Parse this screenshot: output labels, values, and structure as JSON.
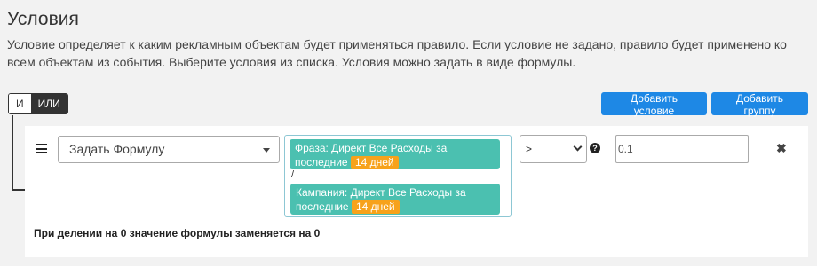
{
  "header": {
    "title": "Условия",
    "description": "Условие определяет к каким рекламным объектам будет применяться правило. Если условие не задано, правило будет применено ко всем объектам из события. Выберите условия из списка. Условия можно задать в виде формулы."
  },
  "logic_toggle": {
    "and_label": "И",
    "or_label": "ИЛИ",
    "selected": "ИЛИ"
  },
  "actions": {
    "add_condition_label": "Добавить условие",
    "add_group_label": "Добавить группу"
  },
  "condition": {
    "type_select": {
      "value": "Задать Формулу"
    },
    "formula": {
      "term1": {
        "text": "Фраза: Директ Все Расходы за последние",
        "period": "14 дней"
      },
      "operator": "/",
      "term2": {
        "text": "Кампания: Директ Все Расходы за последние",
        "period": "14 дней"
      }
    },
    "comparison_select": {
      "value": ">"
    },
    "value_input": {
      "value": "0.1"
    },
    "help_icon": "?",
    "remove_icon": "✖",
    "division_note": "При делении на 0 значение формулы заменяется на 0"
  },
  "colors": {
    "primary": "#1e88e5",
    "chip": "#4bc0b0",
    "period_badge": "#f7a21b",
    "formula_border": "#8dc7d4"
  },
  "icons": [
    "drag-handle-icon",
    "caret-down-icon",
    "chevron-down-icon",
    "help-icon",
    "close-icon"
  ]
}
